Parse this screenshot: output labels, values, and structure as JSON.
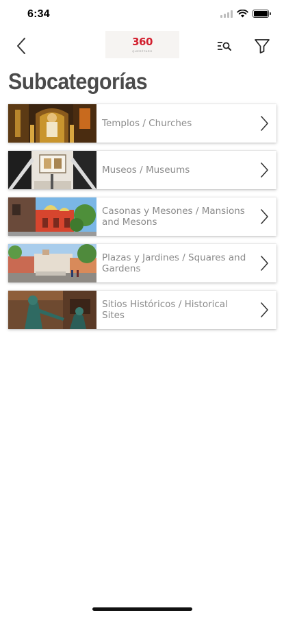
{
  "status_bar": {
    "time": "6:34",
    "signal_icon": "cellular-signal-icon",
    "wifi_icon": "wifi-icon",
    "battery_icon": "battery-icon"
  },
  "nav_bar": {
    "back_icon": "chevron-left-icon",
    "logo_text": "360",
    "logo_subtext": "QUERÉTARO",
    "logo_color": "#d2202f",
    "search_list_icon": "list-search-icon",
    "filter_icon": "filter-funnel-icon"
  },
  "page": {
    "title": "Subcategorías"
  },
  "categories": [
    {
      "label": "Templos / Churches",
      "thumbnail": "church-interior-photo"
    },
    {
      "label": "Museos / Museums",
      "thumbnail": "museum-staircase-photo"
    },
    {
      "label": "Casonas y Mesones / Mansions and Mesons",
      "thumbnail": "colonial-mansion-photo"
    },
    {
      "label": "Plazas y Jardines / Squares and Gardens",
      "thumbnail": "town-square-photo"
    },
    {
      "label": "Sitios Históricos / Historical Sites",
      "thumbnail": "historical-statue-photo"
    }
  ],
  "colors": {
    "title": "#4b4b4b",
    "label": "#8a8a8a",
    "chevron": "#333333",
    "brand_red": "#d2202f"
  }
}
